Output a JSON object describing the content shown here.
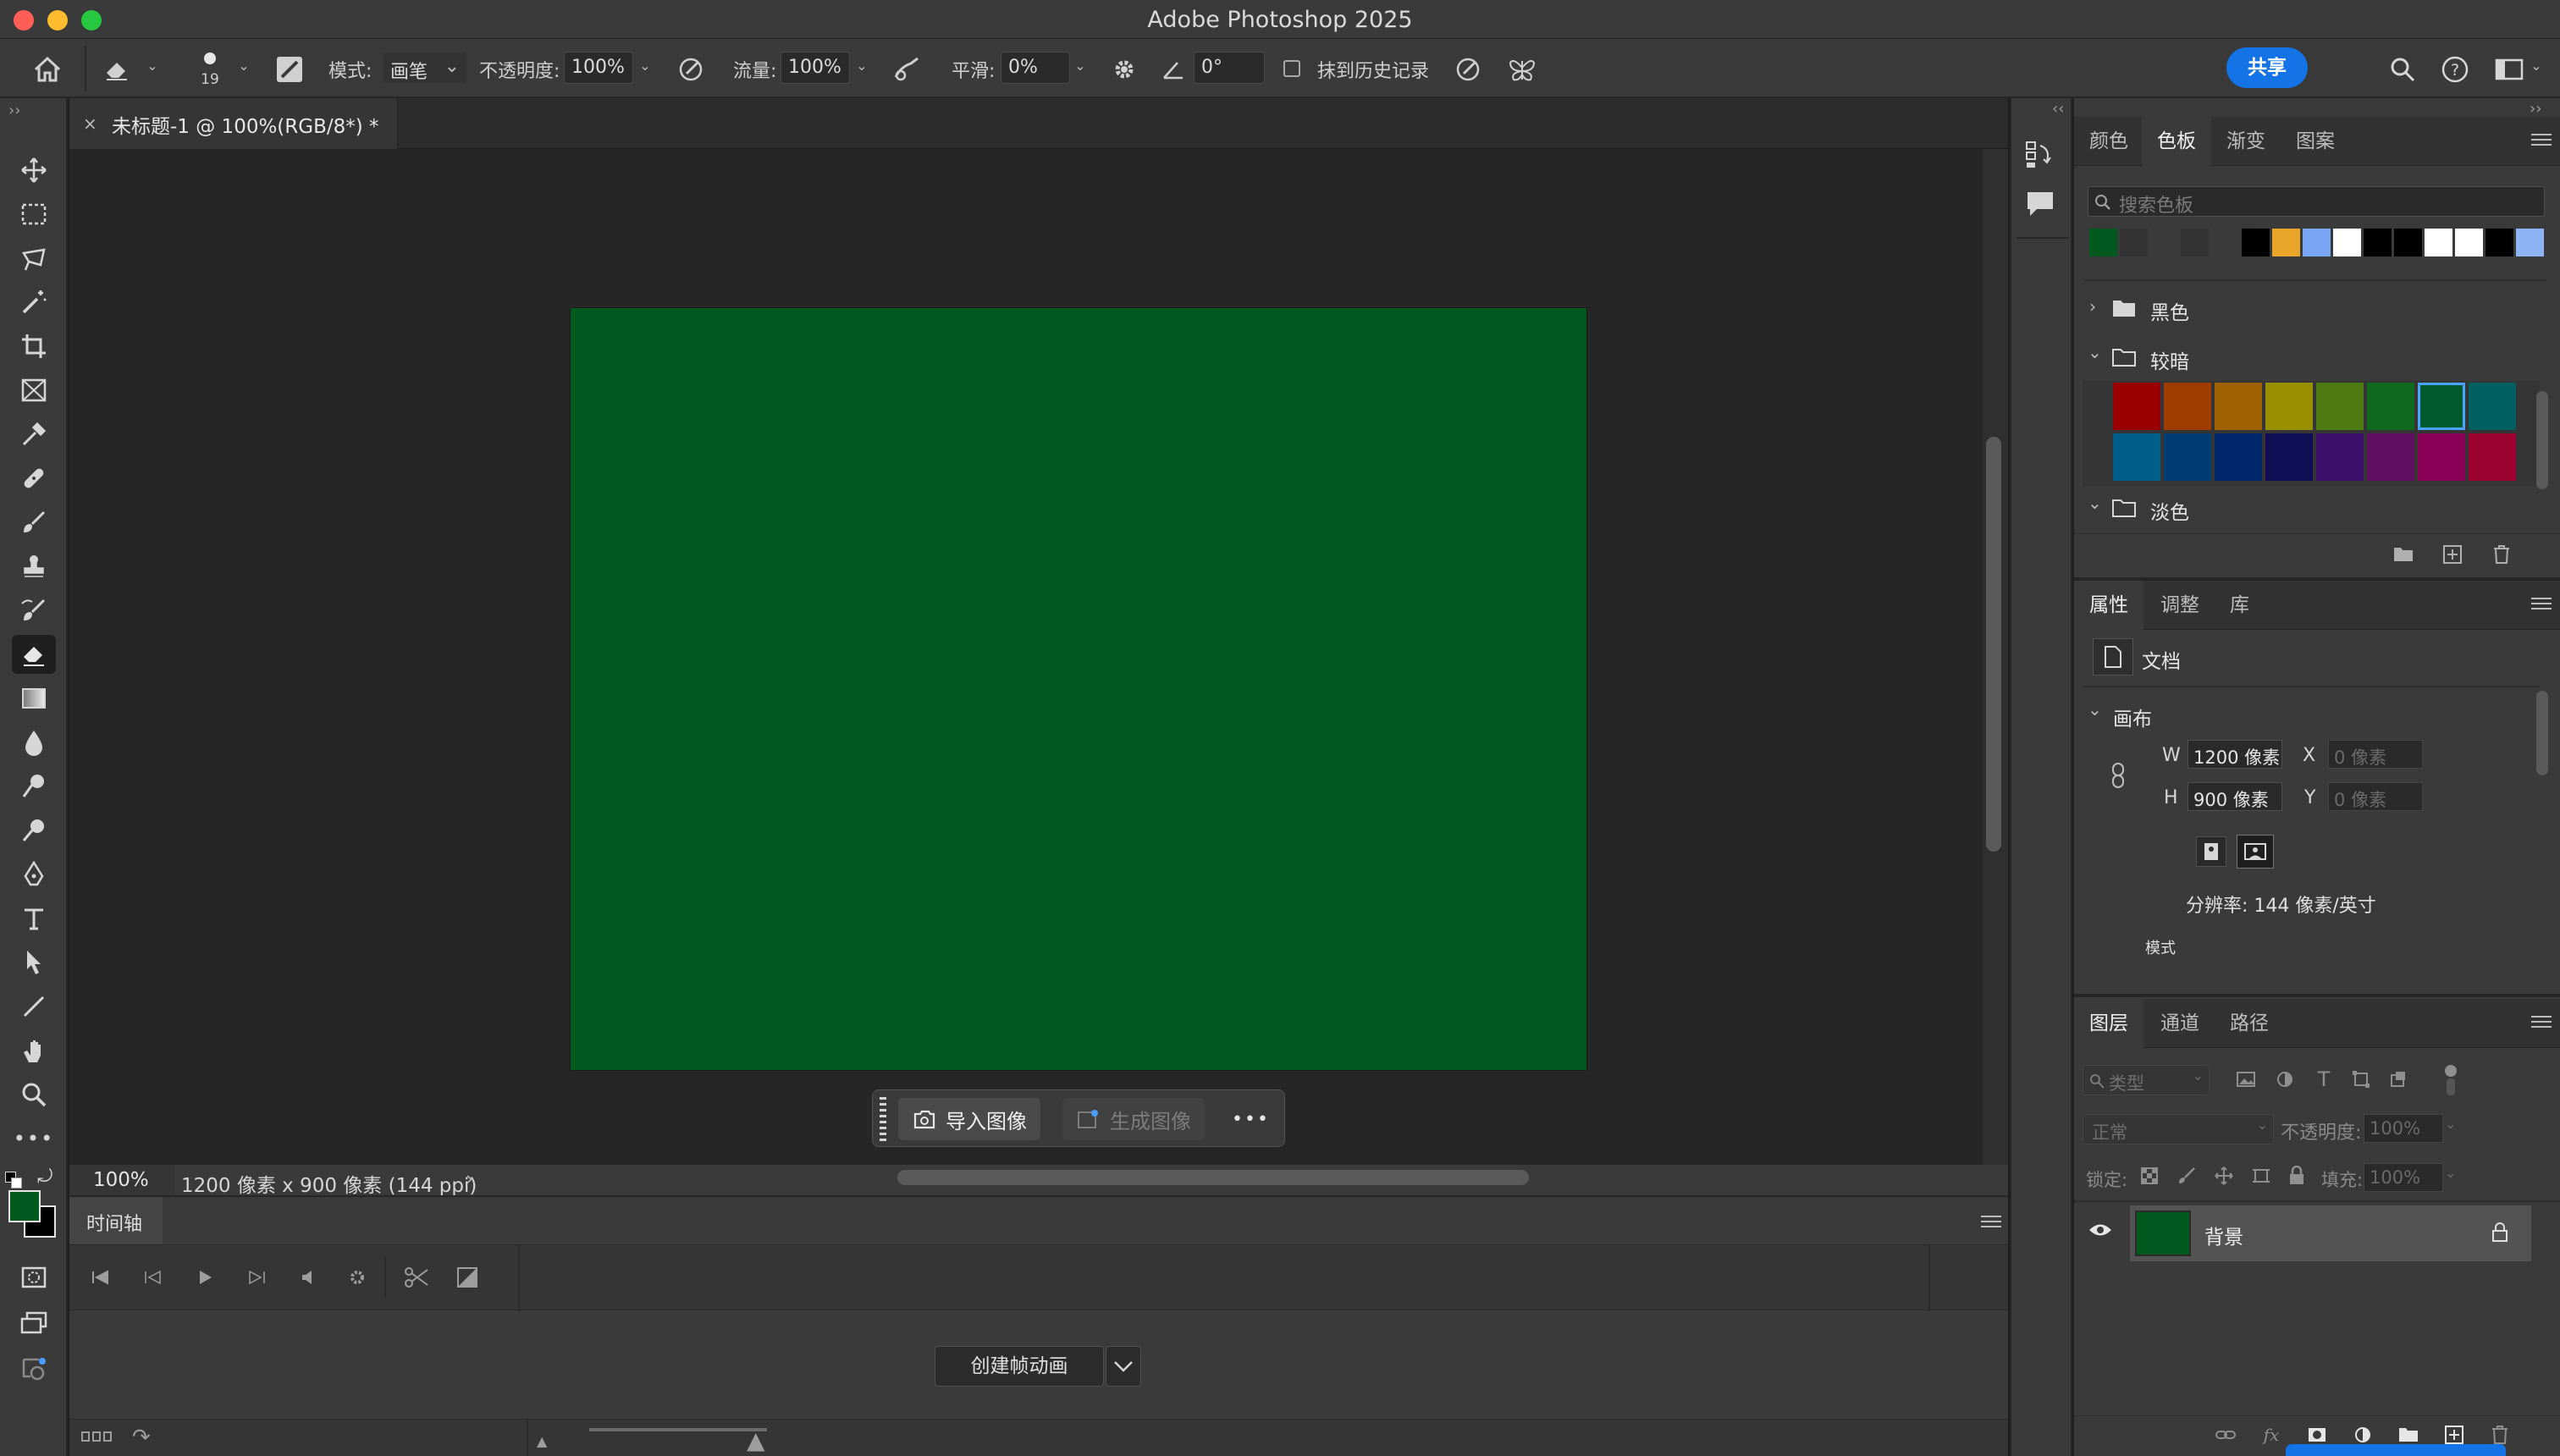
{
  "app": {
    "title": "Adobe Photoshop 2025"
  },
  "optionsbar": {
    "brush_size": "19",
    "mode_label": "模式:",
    "mode_value": "画笔",
    "opacity_label": "不透明度:",
    "opacity_value": "100%",
    "flow_label": "流量:",
    "flow_value": "100%",
    "smoothing_label": "平滑:",
    "smoothing_value": "0%",
    "angle_value": "0°",
    "erase_history_label": "抹到历史记录",
    "share_label": "共享"
  },
  "document": {
    "tab_title": "未标题-1 @ 100%(RGB/8*) *",
    "canvas_color": "#005a1f",
    "zoom": "100%",
    "status_info": "1200 像素 x 900 像素 (144 ppi)"
  },
  "contextbar": {
    "import_label": "导入图像",
    "generate_label": "生成图像"
  },
  "timeline": {
    "tab_label": "时间轴",
    "create_label": "创建帧动画"
  },
  "swatches_panel": {
    "tabs": [
      "颜色",
      "色板",
      "渐变",
      "图案"
    ],
    "active_tab": 1,
    "search_placeholder": "搜索色板",
    "recent": [
      "#005a1f",
      "#333333",
      "#3a3a3a",
      "#333333",
      "#3a3a3a",
      "#000000",
      "#e8a52a",
      "#7aa7f5",
      "#ffffff",
      "#000000",
      "#000000",
      "#ffffff",
      "#ffffff",
      "#000000",
      "#8fb4f5"
    ],
    "groups": [
      {
        "name": "黑色",
        "expanded": false
      },
      {
        "name": "较暗",
        "expanded": true
      },
      {
        "name": "淡色",
        "expanded": true
      }
    ],
    "darker_colors": [
      "#9b0000",
      "#a03b00",
      "#a06200",
      "#999000",
      "#4e7a12",
      "#0f6a1e",
      "#005a2c",
      "#006060",
      "#005f8a",
      "#003c72",
      "#00266b",
      "#0e0f55",
      "#3b0f6a",
      "#5f0f62",
      "#8a0057",
      "#9a0030"
    ],
    "selected_index": 6
  },
  "properties_panel": {
    "tabs": [
      "属性",
      "调整",
      "库"
    ],
    "active_tab": 0,
    "doc_label": "文档",
    "canvas_section": "画布",
    "w_label": "W",
    "w_value": "1200 像素",
    "h_label": "H",
    "h_value": "900 像素",
    "x_label": "X",
    "x_placeholder": "0 像素",
    "y_label": "Y",
    "y_placeholder": "0 像素",
    "resolution": "分辨率: 144 像素/英寸",
    "mode_label": "模式"
  },
  "layers_panel": {
    "tabs": [
      "图层",
      "通道",
      "路径"
    ],
    "active_tab": 0,
    "filter_placeholder": "类型",
    "blend_mode": "正常",
    "opacity_label": "不透明度:",
    "opacity_value": "100%",
    "lock_label": "锁定:",
    "fill_label": "填充:",
    "fill_value": "100%",
    "layers": [
      {
        "name": "背景",
        "color": "#005a1f",
        "locked": true
      }
    ]
  }
}
